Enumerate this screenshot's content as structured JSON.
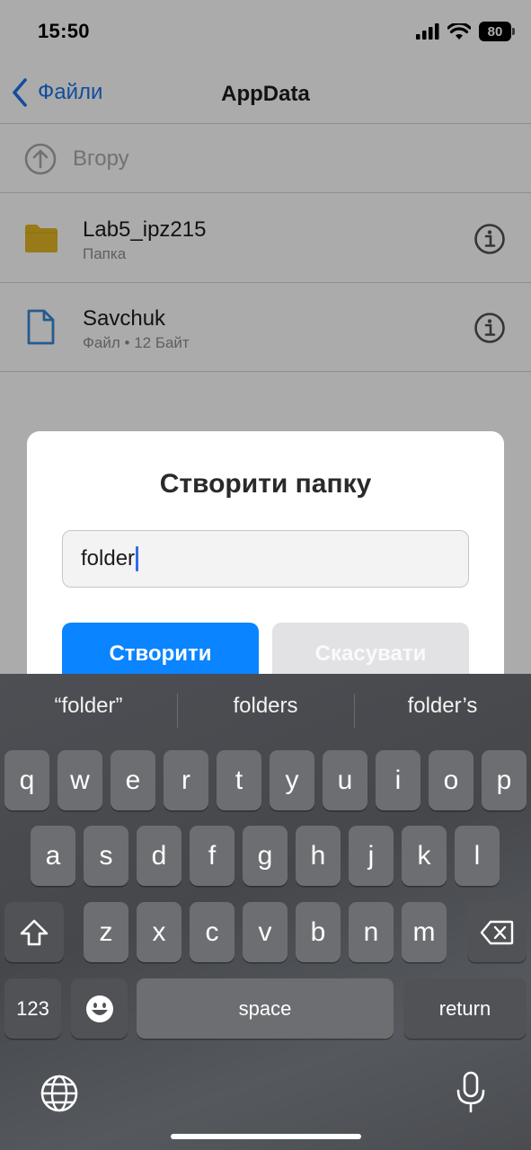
{
  "status": {
    "time": "15:50",
    "battery": "80"
  },
  "nav": {
    "back_label": "Файли",
    "title": "AppData"
  },
  "up_row": {
    "label": "Вгору"
  },
  "files": [
    {
      "name": "Lab5_ipz215",
      "subtitle": "Папка",
      "icon": "folder-icon"
    },
    {
      "name": "Savchuk",
      "subtitle": "Файл • 12 Байт",
      "icon": "document-icon"
    }
  ],
  "dialog": {
    "title": "Створити папку",
    "input_value": "folder",
    "create_label": "Створити",
    "cancel_label": "Скасувати"
  },
  "keyboard": {
    "suggestions": [
      "“folder”",
      "folders",
      "folder’s"
    ],
    "row1": [
      "q",
      "w",
      "e",
      "r",
      "t",
      "y",
      "u",
      "i",
      "o",
      "p"
    ],
    "row2": [
      "a",
      "s",
      "d",
      "f",
      "g",
      "h",
      "j",
      "k",
      "l"
    ],
    "row3": [
      "z",
      "x",
      "c",
      "v",
      "b",
      "n",
      "m"
    ],
    "numbers_label": "123",
    "space_label": "space",
    "return_label": "return"
  },
  "colors": {
    "accent": "#0a84ff",
    "link": "#1a73e8",
    "folder": "#e3b625"
  }
}
